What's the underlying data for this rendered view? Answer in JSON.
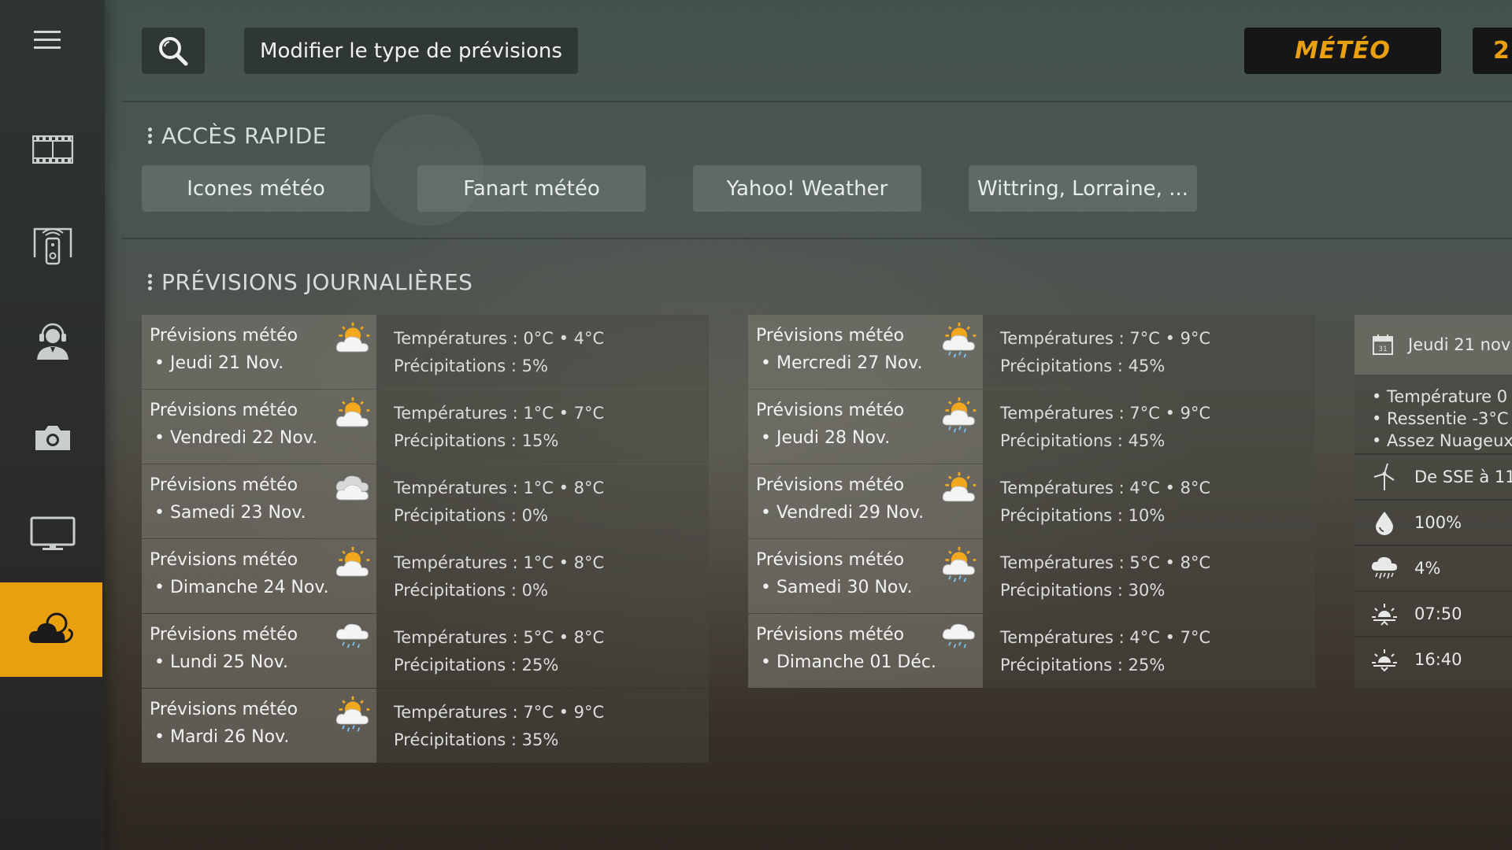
{
  "header": {
    "modify_label": "Modifier le type de prévisions",
    "meteo_tab": "MÉTÉO",
    "date_tab_partial": "2"
  },
  "sidebar": {
    "items": [
      {
        "icon": "menu-icon"
      },
      {
        "icon": "film-icon"
      },
      {
        "icon": "remote-control-icon"
      },
      {
        "icon": "headset-user-icon"
      },
      {
        "icon": "camera-icon"
      },
      {
        "icon": "tv-monitor-icon"
      },
      {
        "icon": "weather-cloud-icon",
        "active": true
      }
    ]
  },
  "quick_access": {
    "title": "ACCÈS RAPIDE",
    "buttons": [
      "Icones météo",
      "Fanart météo",
      "Yahoo! Weather",
      "Wittring, Lorraine, ..."
    ]
  },
  "daily": {
    "title": "PRÉVISIONS JOURNALIÈRES",
    "days": [
      {
        "title": "Prévisions météo",
        "date": "• Jeudi 21 Nov.",
        "temp": "Températures : 0°C • 4°C",
        "prec": "Précipitations : 5%",
        "icon": "partly-cloudy-icon"
      },
      {
        "title": "Prévisions météo",
        "date": "• Vendredi 22 Nov.",
        "temp": "Températures : 1°C • 7°C",
        "prec": "Précipitations : 15%",
        "icon": "partly-cloudy-icon"
      },
      {
        "title": "Prévisions météo",
        "date": "• Samedi 23 Nov.",
        "temp": "Températures : 1°C • 8°C",
        "prec": "Précipitations : 0%",
        "icon": "cloudy-icon"
      },
      {
        "title": "Prévisions météo",
        "date": "• Dimanche 24 Nov.",
        "temp": "Températures : 1°C • 8°C",
        "prec": "Précipitations : 0%",
        "icon": "partly-cloudy-icon"
      },
      {
        "title": "Prévisions météo",
        "date": "• Lundi 25 Nov.",
        "temp": "Températures : 5°C • 8°C",
        "prec": "Précipitations : 25%",
        "icon": "cloud-rain-icon"
      },
      {
        "title": "Prévisions météo",
        "date": "• Mardi 26 Nov.",
        "temp": "Températures : 7°C • 9°C",
        "prec": "Précipitations : 35%",
        "icon": "sun-cloud-rain-icon"
      },
      {
        "title": "Prévisions météo",
        "date": "• Mercredi 27 Nov.",
        "temp": "Températures : 7°C • 9°C",
        "prec": "Précipitations : 45%",
        "icon": "sun-cloud-rain-icon"
      },
      {
        "title": "Prévisions météo",
        "date": "• Jeudi 28 Nov.",
        "temp": "Températures : 7°C • 9°C",
        "prec": "Précipitations : 45%",
        "icon": "sun-cloud-rain-icon"
      },
      {
        "title": "Prévisions météo",
        "date": "• Vendredi 29 Nov.",
        "temp": "Températures : 4°C • 8°C",
        "prec": "Précipitations : 10%",
        "icon": "partly-cloudy-icon"
      },
      {
        "title": "Prévisions météo",
        "date": "• Samedi 30 Nov.",
        "temp": "Températures : 5°C • 8°C",
        "prec": "Précipitations : 30%",
        "icon": "sun-cloud-rain-icon"
      },
      {
        "title": "Prévisions météo",
        "date": "• Dimanche 01 Déc.",
        "temp": "Températures : 4°C • 7°C",
        "prec": "Précipitations : 25%",
        "icon": "cloud-rain-icon"
      }
    ]
  },
  "detail": {
    "date": "Jeudi 21 nov",
    "lines": [
      "• Température 0",
      "• Ressentie -3°C",
      "• Assez Nuageux"
    ],
    "wind": "De SSE à 11",
    "humidity": "100%",
    "precipitation": "4%",
    "sunrise": "07:50",
    "sunset": "16:40"
  }
}
